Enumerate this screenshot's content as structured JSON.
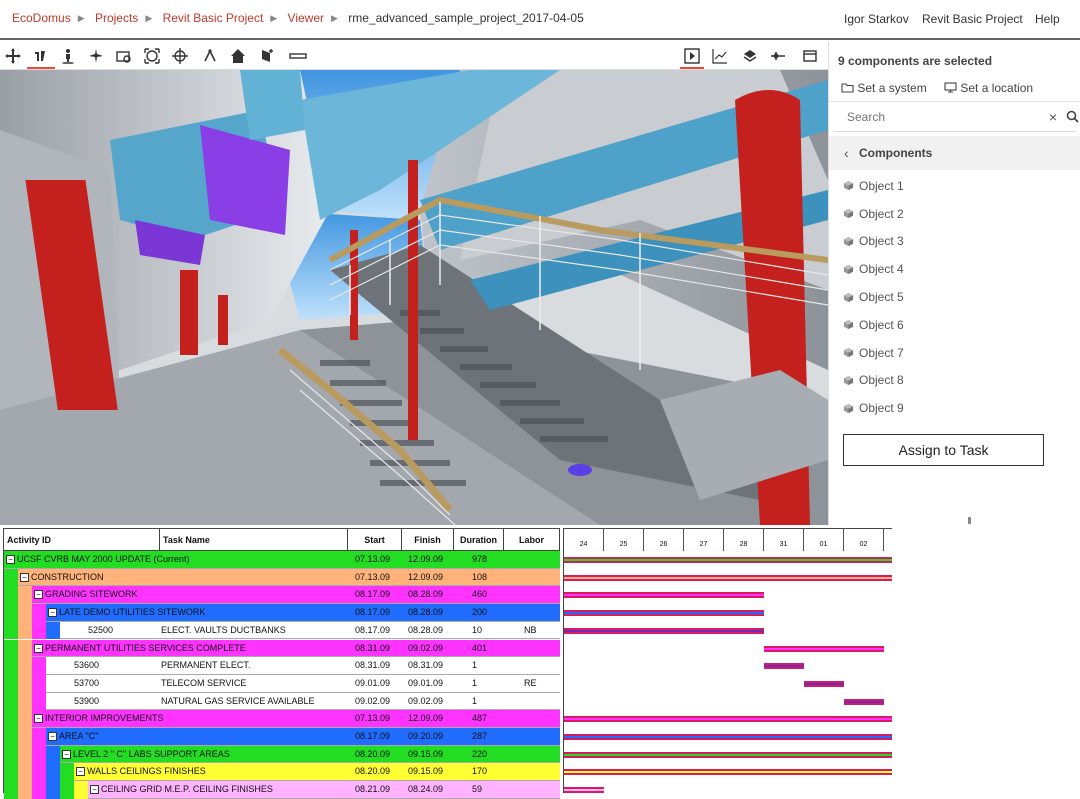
{
  "header": {
    "breadcrumbs": [
      "EcoDomus",
      "Projects",
      "Revit Basic Project",
      "Viewer",
      "rme_advanced_sample_project_2017-04-05"
    ],
    "user": "Igor Starkov",
    "project": "Revit Basic Project",
    "help": "Help"
  },
  "toolbar": {
    "tools": [
      "pan-tool",
      "orbit-tool",
      "walk-tool",
      "fly-tool",
      "zoom-window-tool",
      "fit-to-view-tool",
      "center-tool",
      "measure-tool",
      "home-tool",
      "select-tool",
      "section-tool"
    ],
    "right_tools": [
      "player-tool",
      "chart-tool",
      "layers-tool",
      "settings-tool",
      "window-tool"
    ]
  },
  "panel": {
    "selected_text": "9 components are selected",
    "set_system": "Set a system",
    "set_location": "Set a location",
    "search_placeholder": "Search",
    "components_label": "Components",
    "objects": [
      "Object 1",
      "Object 2",
      "Object 3",
      "Object 4",
      "Object 5",
      "Object 6",
      "Object 7",
      "Object 8",
      "Object 9"
    ],
    "assign_button": "Assign to Task"
  },
  "gantt": {
    "columns": [
      "Activity ID",
      "Task Name",
      "Start",
      "Finish",
      "Duration",
      "Labor"
    ],
    "rows": [
      {
        "id": "UCSF CVRB MAY 2000 UPDATE  (Current)",
        "task": "",
        "start": "07.13.09",
        "finish": "12.09.09",
        "duration": "978",
        "labor": "",
        "color": "#22dd22",
        "indent": 0,
        "group": true
      },
      {
        "id": "CONSTRUCTION",
        "task": "",
        "start": "07.13.09",
        "finish": "12.09.09",
        "duration": "108",
        "labor": "",
        "color": "#ffb37a",
        "indent": 1,
        "group": true
      },
      {
        "id": "GRADING   SITEWORK",
        "task": "",
        "start": "08.17.09",
        "finish": "08.28.09",
        "duration": "460",
        "labor": "",
        "color": "#ff33ff",
        "indent": 2,
        "group": true
      },
      {
        "id": "LATE DEMO   UTILITIES   SITEWORK",
        "task": "",
        "start": "08.17.09",
        "finish": "08.28.09",
        "duration": "200",
        "labor": "",
        "color": "#1f6cff",
        "indent": 3,
        "group": true
      },
      {
        "id": "52500",
        "task": "ELECT. VAULTS   DUCTBANKS",
        "start": "08.17.09",
        "finish": "08.28.09",
        "duration": "10",
        "labor": "NB",
        "color": "#ffffff",
        "indent": 4,
        "group": false
      },
      {
        "id": "PERMANENT UTILITIES SERVICES COMPLETE",
        "task": "",
        "start": "08.31.09",
        "finish": "09.02.09",
        "duration": "401",
        "labor": "",
        "color": "#ff33ff",
        "indent": 2,
        "group": true
      },
      {
        "id": "53600",
        "task": "PERMANENT ELECT.",
        "start": "08.31.09",
        "finish": "08.31.09",
        "duration": "1",
        "labor": "",
        "color": "#ffffff",
        "indent": 3,
        "group": false
      },
      {
        "id": "53700",
        "task": "TELECOM SERVICE",
        "start": "09.01.09",
        "finish": "09.01.09",
        "duration": "1",
        "labor": "RE",
        "color": "#ffffff",
        "indent": 3,
        "group": false
      },
      {
        "id": "53900",
        "task": "NATURAL GAS SERVICE AVAILABLE",
        "start": "09.02.09",
        "finish": "09.02.09",
        "duration": "1",
        "labor": "",
        "color": "#ffffff",
        "indent": 3,
        "group": false
      },
      {
        "id": "INTERIOR IMPROVEMENTS",
        "task": "",
        "start": "07.13.09",
        "finish": "12.09.09",
        "duration": "487",
        "labor": "",
        "color": "#ff33ff",
        "indent": 2,
        "group": true
      },
      {
        "id": "AREA \"C\"",
        "task": "",
        "start": "08.17.09",
        "finish": "09.20.09",
        "duration": "287",
        "labor": "",
        "color": "#1f6cff",
        "indent": 3,
        "group": true
      },
      {
        "id": "LEVEL 2 \" C\" LABS   SUPPORT AREAS",
        "task": "",
        "start": "08.20.09",
        "finish": "09.15.09",
        "duration": "220",
        "labor": "",
        "color": "#22dd22",
        "indent": 4,
        "group": true
      },
      {
        "id": "WALLS   CEILINGS   FINISHES",
        "task": "",
        "start": "08.20.09",
        "finish": "09.15.09",
        "duration": "170",
        "labor": "",
        "color": "#ffff33",
        "indent": 5,
        "group": true
      },
      {
        "id": "CEILING GRID  M.E.P. CEILING FINISHES",
        "task": "",
        "start": "08.21.09",
        "finish": "08.24.09",
        "duration": "59",
        "labor": "",
        "color": "#ffb3ff",
        "indent": 6,
        "group": true
      }
    ],
    "timeline": [
      "24",
      "25",
      "26",
      "27",
      "28",
      "31",
      "01",
      "02"
    ]
  }
}
